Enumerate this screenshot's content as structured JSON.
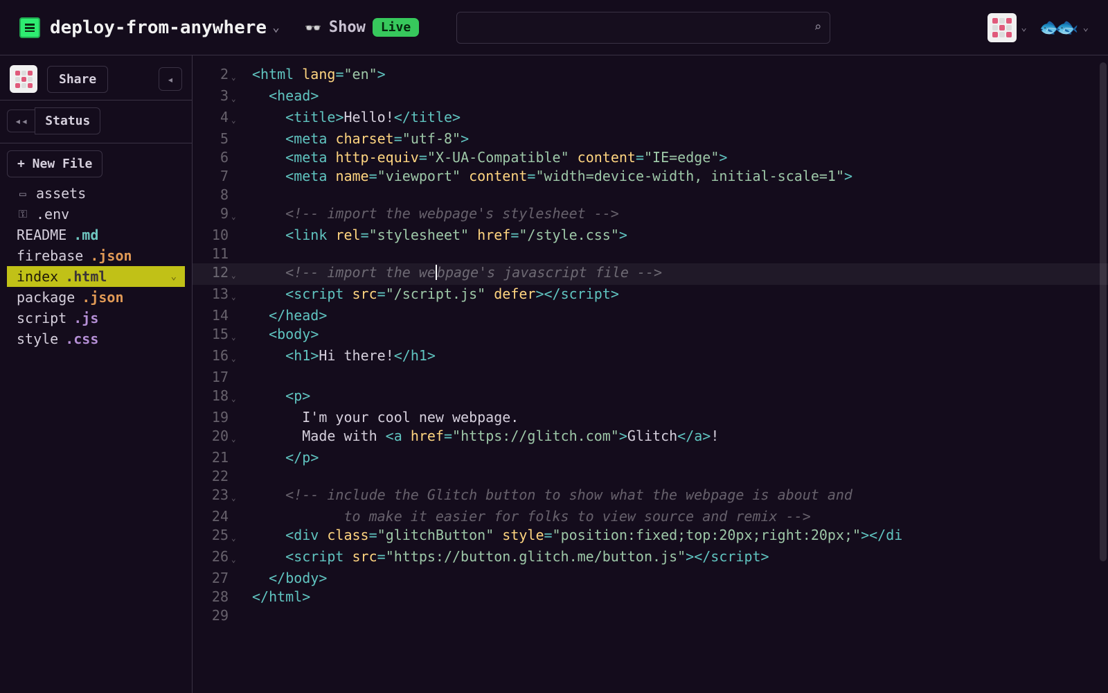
{
  "header": {
    "project_name": "deploy-from-anywhere",
    "show_label": "Show",
    "live_label": "Live",
    "search_placeholder": ""
  },
  "sidebar": {
    "share_label": "Share",
    "status_label": "Status",
    "new_file_label": "+ New File",
    "files": [
      {
        "icon": "box-icon",
        "name": "assets",
        "ext": "",
        "ext_class": ""
      },
      {
        "icon": "key-icon",
        "name": ".env",
        "ext": "",
        "ext_class": ""
      },
      {
        "icon": "",
        "name": "README",
        "ext": ".md",
        "ext_class": "ext-md"
      },
      {
        "icon": "",
        "name": "firebase",
        "ext": ".json",
        "ext_class": "ext-json"
      },
      {
        "icon": "",
        "name": "index",
        "ext": ".html",
        "ext_class": "ext-html",
        "selected": true
      },
      {
        "icon": "",
        "name": "package",
        "ext": ".json",
        "ext_class": "ext-json"
      },
      {
        "icon": "",
        "name": "script",
        "ext": ".js",
        "ext_class": "ext-js"
      },
      {
        "icon": "",
        "name": "style",
        "ext": ".css",
        "ext_class": "ext-css"
      }
    ]
  },
  "editor": {
    "current_line": 12,
    "lines": [
      {
        "n": 2,
        "fold": "v",
        "tokens": [
          [
            "punc",
            "<"
          ],
          [
            "tag",
            "html"
          ],
          [
            "txt",
            " "
          ],
          [
            "attr",
            "lang"
          ],
          [
            "punc",
            "="
          ],
          [
            "str",
            "\"en\""
          ],
          [
            "punc",
            ">"
          ]
        ]
      },
      {
        "n": 3,
        "fold": "v",
        "indent": 1,
        "tokens": [
          [
            "punc",
            "<"
          ],
          [
            "tag",
            "head"
          ],
          [
            "punc",
            ">"
          ]
        ]
      },
      {
        "n": 4,
        "fold": "v",
        "indent": 2,
        "tokens": [
          [
            "punc",
            "<"
          ],
          [
            "tag",
            "title"
          ],
          [
            "punc",
            ">"
          ],
          [
            "txt",
            "Hello!"
          ],
          [
            "punc",
            "</"
          ],
          [
            "tag",
            "title"
          ],
          [
            "punc",
            ">"
          ]
        ]
      },
      {
        "n": 5,
        "fold": "",
        "indent": 2,
        "tokens": [
          [
            "punc",
            "<"
          ],
          [
            "tag",
            "meta"
          ],
          [
            "txt",
            " "
          ],
          [
            "attr",
            "charset"
          ],
          [
            "punc",
            "="
          ],
          [
            "str",
            "\"utf-8\""
          ],
          [
            "punc",
            ">"
          ]
        ]
      },
      {
        "n": 6,
        "fold": "",
        "indent": 2,
        "tokens": [
          [
            "punc",
            "<"
          ],
          [
            "tag",
            "meta"
          ],
          [
            "txt",
            " "
          ],
          [
            "attr",
            "http-equiv"
          ],
          [
            "punc",
            "="
          ],
          [
            "str",
            "\"X-UA-Compatible\""
          ],
          [
            "txt",
            " "
          ],
          [
            "attr",
            "content"
          ],
          [
            "punc",
            "="
          ],
          [
            "str",
            "\"IE=edge\""
          ],
          [
            "punc",
            ">"
          ]
        ]
      },
      {
        "n": 7,
        "fold": "",
        "indent": 2,
        "tokens": [
          [
            "punc",
            "<"
          ],
          [
            "tag",
            "meta"
          ],
          [
            "txt",
            " "
          ],
          [
            "attr",
            "name"
          ],
          [
            "punc",
            "="
          ],
          [
            "str",
            "\"viewport\""
          ],
          [
            "txt",
            " "
          ],
          [
            "attr",
            "content"
          ],
          [
            "punc",
            "="
          ],
          [
            "str",
            "\"width=device-width, initial-scale=1\""
          ],
          [
            "punc",
            ">"
          ]
        ]
      },
      {
        "n": 8,
        "fold": "",
        "indent": 0,
        "tokens": []
      },
      {
        "n": 9,
        "fold": "v",
        "indent": 2,
        "tokens": [
          [
            "com",
            "<!-- import the webpage's stylesheet -->"
          ]
        ]
      },
      {
        "n": 10,
        "fold": "",
        "indent": 2,
        "tokens": [
          [
            "punc",
            "<"
          ],
          [
            "tag",
            "link"
          ],
          [
            "txt",
            " "
          ],
          [
            "attr",
            "rel"
          ],
          [
            "punc",
            "="
          ],
          [
            "str",
            "\"stylesheet\""
          ],
          [
            "txt",
            " "
          ],
          [
            "attr",
            "href"
          ],
          [
            "punc",
            "="
          ],
          [
            "str",
            "\"/style.css\""
          ],
          [
            "punc",
            ">"
          ]
        ]
      },
      {
        "n": 11,
        "fold": "",
        "indent": 0,
        "tokens": []
      },
      {
        "n": 12,
        "fold": "v",
        "indent": 2,
        "tokens": [
          [
            "com",
            "<!-- import the we"
          ],
          [
            "caret",
            ""
          ],
          [
            "com",
            "bpage's javascript file -->"
          ]
        ]
      },
      {
        "n": 13,
        "fold": "v",
        "indent": 2,
        "tokens": [
          [
            "punc",
            "<"
          ],
          [
            "tag",
            "script"
          ],
          [
            "txt",
            " "
          ],
          [
            "attr",
            "src"
          ],
          [
            "punc",
            "="
          ],
          [
            "str",
            "\"/script.js\""
          ],
          [
            "txt",
            " "
          ],
          [
            "attr",
            "defer"
          ],
          [
            "punc",
            "></"
          ],
          [
            "tag",
            "script"
          ],
          [
            "punc",
            ">"
          ]
        ]
      },
      {
        "n": 14,
        "fold": "",
        "indent": 1,
        "tokens": [
          [
            "punc",
            "</"
          ],
          [
            "tag",
            "head"
          ],
          [
            "punc",
            ">"
          ]
        ]
      },
      {
        "n": 15,
        "fold": "v",
        "indent": 1,
        "tokens": [
          [
            "punc",
            "<"
          ],
          [
            "tag",
            "body"
          ],
          [
            "punc",
            ">"
          ]
        ]
      },
      {
        "n": 16,
        "fold": "v",
        "indent": 2,
        "tokens": [
          [
            "punc",
            "<"
          ],
          [
            "tag",
            "h1"
          ],
          [
            "punc",
            ">"
          ],
          [
            "txt",
            "Hi there!"
          ],
          [
            "punc",
            "</"
          ],
          [
            "tag",
            "h1"
          ],
          [
            "punc",
            ">"
          ]
        ]
      },
      {
        "n": 17,
        "fold": "",
        "indent": 0,
        "tokens": []
      },
      {
        "n": 18,
        "fold": "v",
        "indent": 2,
        "tokens": [
          [
            "punc",
            "<"
          ],
          [
            "tag",
            "p"
          ],
          [
            "punc",
            ">"
          ]
        ]
      },
      {
        "n": 19,
        "fold": "",
        "indent": 3,
        "tokens": [
          [
            "txt",
            "I'm your cool new webpage."
          ]
        ]
      },
      {
        "n": 20,
        "fold": "v",
        "indent": 3,
        "tokens": [
          [
            "txt",
            "Made with "
          ],
          [
            "punc",
            "<"
          ],
          [
            "tag",
            "a"
          ],
          [
            "txt",
            " "
          ],
          [
            "attr",
            "href"
          ],
          [
            "punc",
            "="
          ],
          [
            "str",
            "\"https://glitch.com\""
          ],
          [
            "punc",
            ">"
          ],
          [
            "txt",
            "Glitch"
          ],
          [
            "punc",
            "</"
          ],
          [
            "tag",
            "a"
          ],
          [
            "punc",
            ">"
          ],
          [
            "txt",
            "!"
          ]
        ]
      },
      {
        "n": 21,
        "fold": "",
        "indent": 2,
        "tokens": [
          [
            "punc",
            "</"
          ],
          [
            "tag",
            "p"
          ],
          [
            "punc",
            ">"
          ]
        ]
      },
      {
        "n": 22,
        "fold": "",
        "indent": 0,
        "tokens": []
      },
      {
        "n": 23,
        "fold": "v",
        "indent": 2,
        "tokens": [
          [
            "com",
            "<!-- include the Glitch button to show what the webpage is about and"
          ]
        ]
      },
      {
        "n": 24,
        "fold": "",
        "indent": 2,
        "tokens": [
          [
            "com",
            "       to make it easier for folks to view source and remix -->"
          ]
        ]
      },
      {
        "n": 25,
        "fold": "v",
        "indent": 2,
        "tokens": [
          [
            "punc",
            "<"
          ],
          [
            "tag",
            "div"
          ],
          [
            "txt",
            " "
          ],
          [
            "attr",
            "class"
          ],
          [
            "punc",
            "="
          ],
          [
            "str",
            "\"glitchButton\""
          ],
          [
            "txt",
            " "
          ],
          [
            "attr",
            "style"
          ],
          [
            "punc",
            "="
          ],
          [
            "str",
            "\"position:fixed;top:20px;right:20px;\""
          ],
          [
            "punc",
            "></"
          ],
          [
            "tag",
            "di"
          ]
        ]
      },
      {
        "n": 26,
        "fold": "v",
        "indent": 2,
        "tokens": [
          [
            "punc",
            "<"
          ],
          [
            "tag",
            "script"
          ],
          [
            "txt",
            " "
          ],
          [
            "attr",
            "src"
          ],
          [
            "punc",
            "="
          ],
          [
            "str",
            "\"https://button.glitch.me/button.js\""
          ],
          [
            "punc",
            "></"
          ],
          [
            "tag",
            "script"
          ],
          [
            "punc",
            ">"
          ]
        ]
      },
      {
        "n": 27,
        "fold": "",
        "indent": 1,
        "tokens": [
          [
            "punc",
            "</"
          ],
          [
            "tag",
            "body"
          ],
          [
            "punc",
            ">"
          ]
        ]
      },
      {
        "n": 28,
        "fold": "",
        "indent": 0,
        "tokens": [
          [
            "punc",
            "</"
          ],
          [
            "tag",
            "html"
          ],
          [
            "punc",
            ">"
          ]
        ]
      },
      {
        "n": 29,
        "fold": "",
        "indent": 0,
        "tokens": []
      }
    ]
  }
}
